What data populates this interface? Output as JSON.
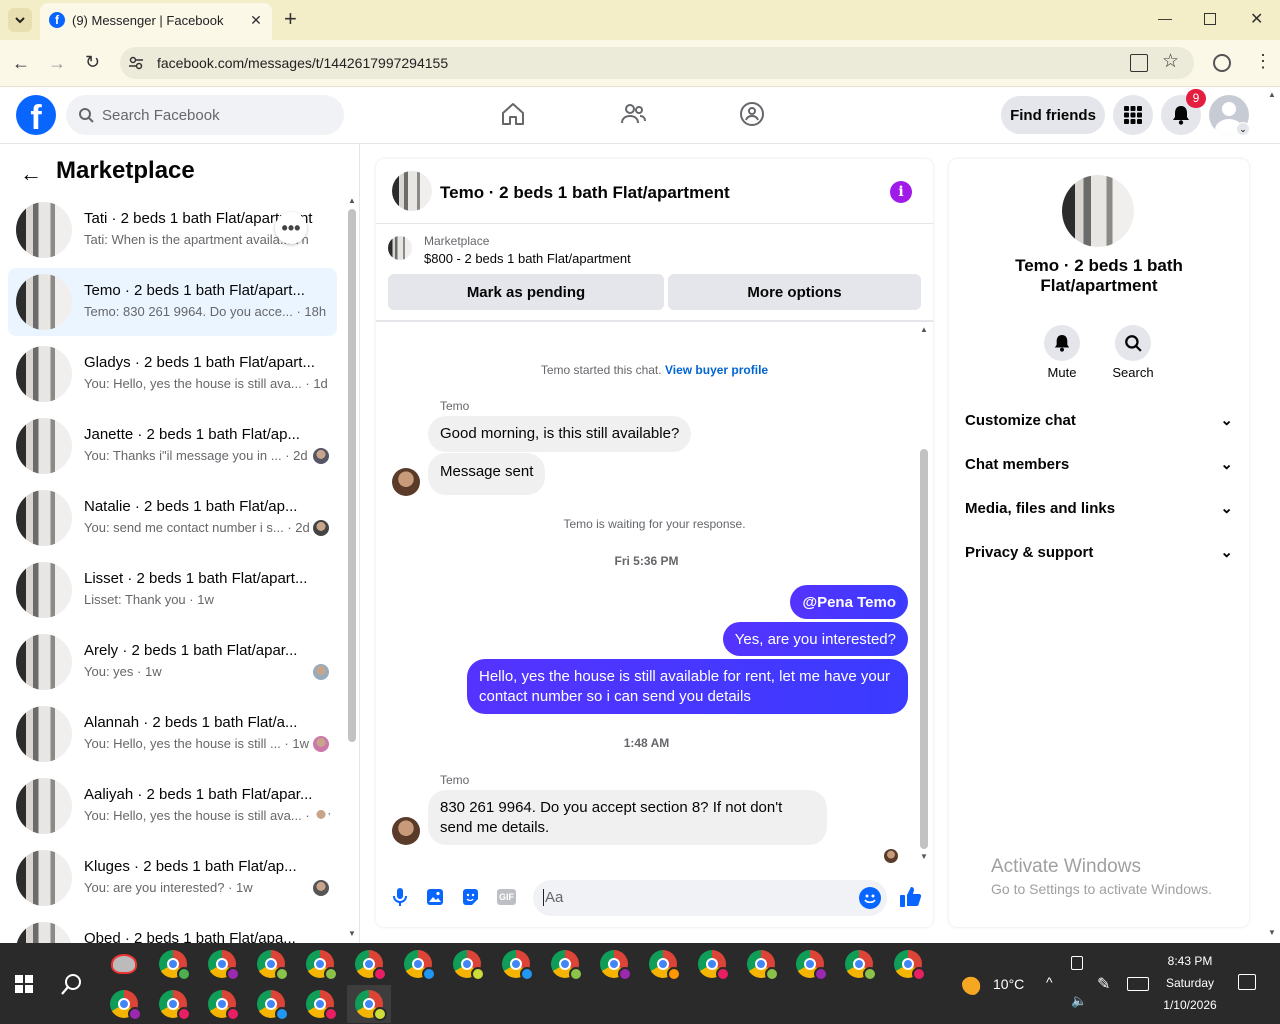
{
  "browser": {
    "tab_title": "(9) Messenger | Facebook",
    "url": "facebook.com/messages/t/1442617997294155"
  },
  "header": {
    "search_placeholder": "Search Facebook",
    "find_friends": "Find friends",
    "notification_count": "9",
    "brand_color": "#0866ff"
  },
  "sidebar": {
    "title": "Marketplace",
    "conversations": [
      {
        "name": "Tati · 2 beds 1 bath Flat/apartment",
        "preview": "Tati: When is the apartment availa...",
        "time": "7h"
      },
      {
        "name": "Temo · 2 beds 1 bath Flat/apart...",
        "preview": "Temo: 830 261 9964. Do you acce...",
        "time": "· 18h"
      },
      {
        "name": "Gladys · 2 beds 1 bath Flat/apart...",
        "preview": "You: Hello, yes the house is still ava...",
        "time": "· 1d"
      },
      {
        "name": "Janette · 2 beds 1 bath Flat/ap...",
        "preview": "You: Thanks i\"il message you in ...",
        "time": "· 2d"
      },
      {
        "name": "Natalie · 2 beds 1 bath Flat/ap...",
        "preview": "You: send me contact number i s...",
        "time": "· 2d"
      },
      {
        "name": "Lisset · 2 beds 1 bath Flat/apart...",
        "preview": "Lisset: Thank you",
        "time": "· 1w"
      },
      {
        "name": "Arely · 2 beds 1 bath Flat/apar...",
        "preview": "You: yes",
        "time": "· 1w"
      },
      {
        "name": "Alannah · 2 beds 1 bath Flat/a...",
        "preview": "You: Hello, yes the house is still ...",
        "time": "· 1w"
      },
      {
        "name": "Aaliyah · 2 beds 1 bath Flat/apar...",
        "preview": "You: Hello, yes the house is still ava...",
        "time": "· 1w"
      },
      {
        "name": "Kluges · 2 beds 1 bath Flat/ap...",
        "preview": "You: are you interested?",
        "time": "· 1w"
      },
      {
        "name": "Obed · 2 beds 1 bath Flat/apa...",
        "preview": "",
        "time": ""
      }
    ]
  },
  "chat": {
    "title": "Temo · 2 beds 1 bath Flat/apartment",
    "listing_label": "Marketplace",
    "listing_text": "$800 - 2 beds 1 bath Flat/apartment",
    "mark_pending": "Mark as pending",
    "more_options": "More options",
    "started_text": "Temo started this chat.",
    "view_buyer_profile": "View buyer profile",
    "sender1": "Temo",
    "msg1": "Good morning, is this still available?",
    "msg2": "Message sent",
    "waiting_text": "Temo is waiting for your response.",
    "time1": "Fri 5:36 PM",
    "out1": "@Pena Temo",
    "out2": "Yes, are you interested?",
    "out3": "Hello, yes the house is still available for rent, let me have your contact number so i can send you details",
    "time2": "1:48 AM",
    "sender2": "Temo",
    "msg3": "830 261 9964. Do you accept section 8? If not don't send me details.",
    "composer_placeholder": "Aa"
  },
  "info": {
    "title": "Temo · 2 beds 1 bath Flat/apartment",
    "mute": "Mute",
    "search": "Search",
    "sections": [
      "Customize chat",
      "Chat members",
      "Media, files and links",
      "Privacy & support"
    ]
  },
  "watermark": {
    "line1": "Activate Windows",
    "line2": "Go to Settings to activate Windows."
  },
  "taskbar": {
    "weather": "10°C",
    "time": "8:43 PM",
    "day": "Saturday",
    "date": "1/10/2026"
  }
}
